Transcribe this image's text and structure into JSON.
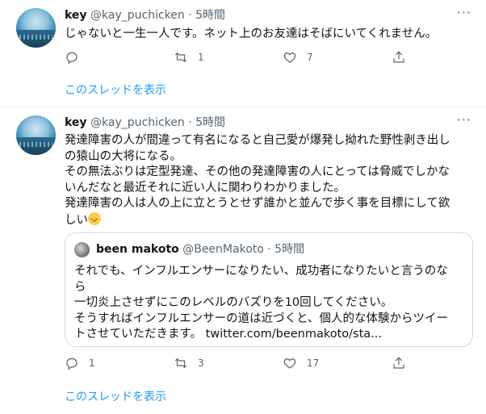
{
  "tweet1": {
    "name": "key",
    "handle": "@kay_puchicken",
    "separator": "·",
    "time": "5時間",
    "text_lines": [
      "じゃないと一生一人です。ネット上のお友達はそばにいてくれません。"
    ],
    "reply_count": "",
    "retweet_count": "1",
    "like_count": "7",
    "show_thread": "このスレッドを表示"
  },
  "tweet2": {
    "name": "key",
    "handle": "@kay_puchicken",
    "separator": "·",
    "time": "5時間",
    "text_lines": [
      "発達障害の人が間違って有名になると自己愛が爆発し拗れた野性剥き出し",
      "の猿山の大将になる。",
      "その無法ぶりは定型発達、その他の発達障害の人にとっては脅威でしかな",
      "いんだなと最近それに近い人に関わりわかりました。",
      "発達障害の人は人の上に立とうとせず誰かと並んで歩く事を目標にして欲",
      "しい"
    ],
    "emoji": "disappointed-face",
    "reply_count": "1",
    "retweet_count": "3",
    "like_count": "17",
    "show_thread": "このスレッドを表示",
    "quote": {
      "name": "been makoto",
      "handle": "@BeenMakoto",
      "separator": "·",
      "time": "5時間",
      "text_lines": [
        "それでも、インフルエンサーになりたい、成功者になりたいと言うのな",
        "ら",
        "一切炎上させずにこのレベルのバズりを10回してください。",
        "そうすればインフルエンサーの道は近づくと、個人的な体験からツイー",
        "トさせていただきます。 twitter.com/beenmakoto/sta..."
      ]
    }
  },
  "icons": {
    "reply": "reply-icon",
    "retweet": "retweet-icon",
    "like": "heart-icon",
    "share": "share-icon",
    "more": "more-icon"
  },
  "colors": {
    "link": "#1d9bf0",
    "secondary_text": "#536471",
    "divider": "#eff3f4"
  }
}
